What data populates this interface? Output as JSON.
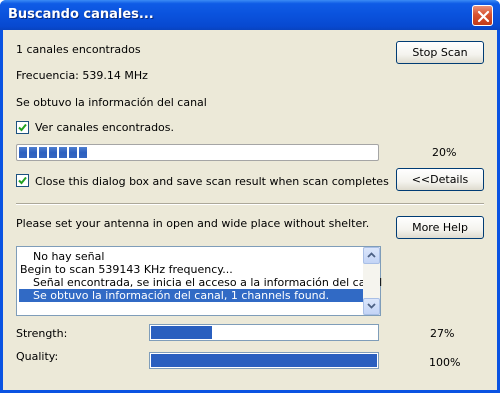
{
  "window": {
    "title": "Buscando canales..."
  },
  "status": {
    "channels_found": "1 canales encontrados",
    "frequency": "Frecuencia: 539.14 MHz",
    "info": "Se obtuvo la información del canal"
  },
  "options": {
    "show_channels_label": "Ver canales encontrados.",
    "show_channels_checked": true,
    "close_dialog_label": "Close this dialog box and save scan result when scan completes",
    "close_dialog_checked": true
  },
  "scan_progress": {
    "percent_text": "20%",
    "value": 0.2,
    "segments": 7
  },
  "buttons": {
    "stop_scan": "Stop Scan",
    "details": "<<Details",
    "more_help": "More Help"
  },
  "antenna_hint": "Please set your antenna in open and wide place without shelter.",
  "log": [
    {
      "text": "No hay señal",
      "selected": false
    },
    {
      "text": "Begin to scan 539143 KHz frequency...",
      "selected": false
    },
    {
      "text": "Señal encontrada, se inicia el acceso a la información del canal",
      "selected": false
    },
    {
      "text": "Se obtuvo la información del canal, 1 channels found.",
      "selected": true
    }
  ],
  "signal": {
    "strength_label": "Strength:",
    "strength_percent": "27%",
    "strength_value": 0.27,
    "quality_label": "Quality:",
    "quality_percent": "100%",
    "quality_value": 1.0
  },
  "icons": {
    "close": "close-x-icon",
    "check": "checkmark-icon",
    "scroll_up": "scroll-up-arrow-icon",
    "scroll_down": "scroll-down-arrow-icon"
  },
  "colors": {
    "title_bar": "#0a53e2",
    "progress": "#2a5fbf",
    "selection": "#316ac5",
    "dialog_bg": "#ece9d8"
  }
}
